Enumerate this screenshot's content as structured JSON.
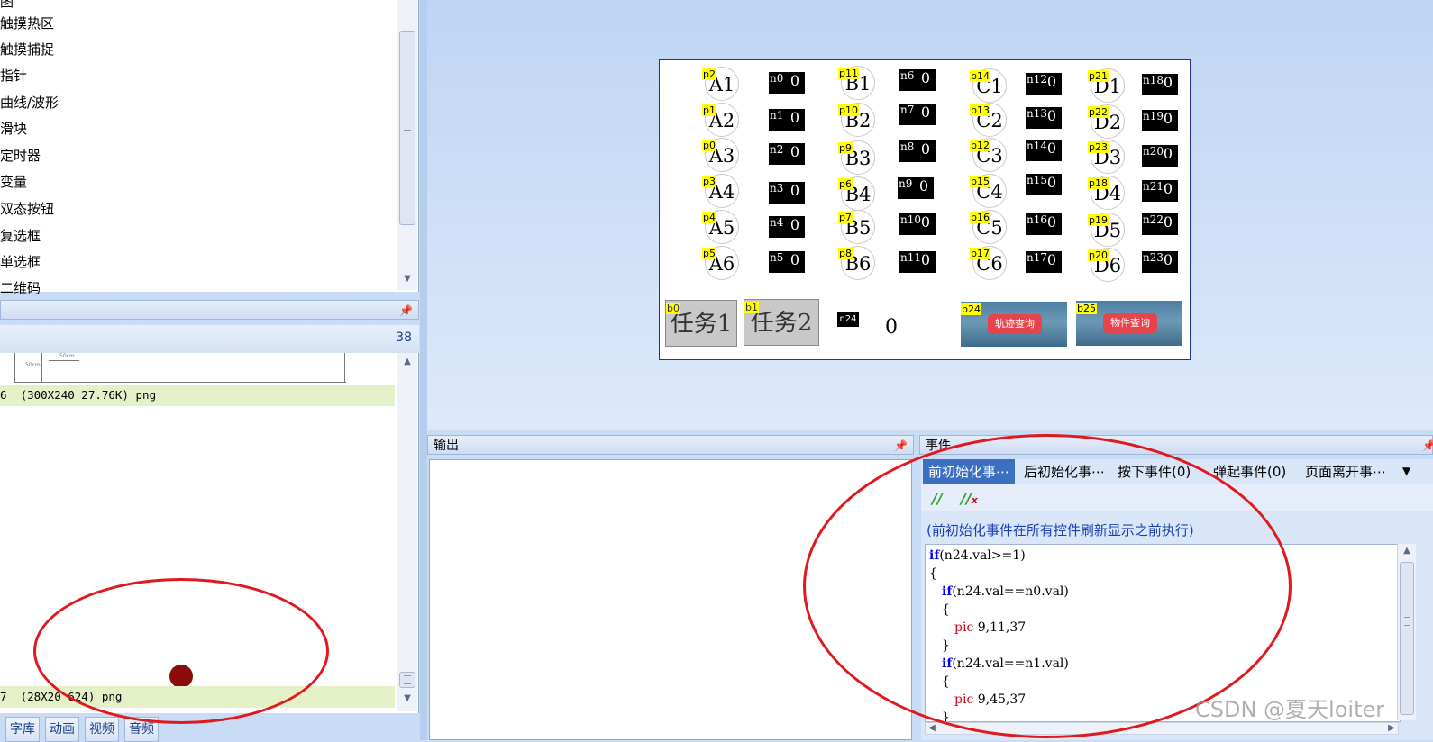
{
  "controls": {
    "items": [
      "图",
      "触摸热区",
      "触摸捕捉",
      "指针",
      "曲线/波形",
      "滑块",
      "定时器",
      "变量",
      "双态按钮",
      "复选框",
      "单选框",
      "二维码"
    ]
  },
  "attr_header": {
    "pin": "📌"
  },
  "image_panel": {
    "count": "38",
    "ruler_labels": [
      "50cm",
      "50cm"
    ],
    "row1": "6  (300X240 27.76K) png",
    "row2": "7  (28X20 624) png",
    "tabs": [
      "字库",
      "动画",
      "视频",
      "音频"
    ]
  },
  "canvas": {
    "circles_a": [
      {
        "tag": "p2",
        "label": "A1"
      },
      {
        "tag": "p1",
        "label": "A2"
      },
      {
        "tag": "p0",
        "label": "A3"
      },
      {
        "tag": "p3",
        "label": "A4"
      },
      {
        "tag": "p4",
        "label": "A5"
      },
      {
        "tag": "p5",
        "label": "A6"
      }
    ],
    "circles_b": [
      {
        "tag": "p11",
        "label": "B1"
      },
      {
        "tag": "p10",
        "label": "B2"
      },
      {
        "tag": "p9",
        "label": "B3"
      },
      {
        "tag": "p6",
        "label": "B4"
      },
      {
        "tag": "p7",
        "label": "B5"
      },
      {
        "tag": "p8",
        "label": "B6"
      }
    ],
    "circles_c": [
      {
        "tag": "p14",
        "label": "C1"
      },
      {
        "tag": "p13",
        "label": "C2"
      },
      {
        "tag": "p12",
        "label": "C3"
      },
      {
        "tag": "p15",
        "label": "C4"
      },
      {
        "tag": "p16",
        "label": "C5"
      },
      {
        "tag": "p17",
        "label": "C6"
      }
    ],
    "circles_d": [
      {
        "tag": "p21",
        "label": "D1"
      },
      {
        "tag": "p22",
        "label": "D2"
      },
      {
        "tag": "p23",
        "label": "D3"
      },
      {
        "tag": "p18",
        "label": "D4"
      },
      {
        "tag": "p19",
        "label": "D5"
      },
      {
        "tag": "p20",
        "label": "D6"
      }
    ],
    "nums_1": [
      "n0",
      "n1",
      "n2",
      "n3",
      "n4",
      "n5"
    ],
    "nums_2": [
      "n6",
      "n7",
      "n8",
      "n9",
      "n10",
      "n11"
    ],
    "nums_3": [
      "n12",
      "n13",
      "n14",
      "n15",
      "n16",
      "n17"
    ],
    "nums_4": [
      "n18",
      "n19",
      "n20",
      "n21",
      "n22",
      "n23"
    ],
    "num_digit": "0",
    "btn_task1": {
      "tag": "b0",
      "label": "任务1"
    },
    "btn_task2": {
      "tag": "b1",
      "label": "任务2"
    },
    "n24": {
      "tag": "n24",
      "value": "0"
    },
    "btn_track": {
      "tag": "b24",
      "label": "轨迹查询"
    },
    "btn_item": {
      "tag": "b25",
      "label": "物件查询"
    }
  },
  "output": {
    "title": "输出",
    "pin": "📌"
  },
  "events": {
    "title": "事件",
    "pin": "📌",
    "tabs": [
      "前初始化事⋯",
      "后初始化事⋯",
      "按下事件(0)",
      "弹起事件(0)",
      "页面离开事⋯"
    ],
    "hint": "(前初始化事件在所有控件刷新显示之前执行)",
    "code": [
      {
        "kw": "if",
        "rest": "(n24.val>=1)",
        "indent": 0
      },
      {
        "kw": "",
        "rest": "{",
        "indent": 0
      },
      {
        "kw": "if",
        "rest": "(n24.val==n0.val)",
        "indent": 1
      },
      {
        "kw": "",
        "rest": "{",
        "indent": 1
      },
      {
        "fn": "pic",
        "rest": " 9,11,37",
        "indent": 2
      },
      {
        "kw": "",
        "rest": "}",
        "indent": 1
      },
      {
        "kw": "if",
        "rest": "(n24.val==n1.val)",
        "indent": 1
      },
      {
        "kw": "",
        "rest": "{",
        "indent": 1
      },
      {
        "fn": "pic",
        "rest": " 9,45,37",
        "indent": 2
      },
      {
        "kw": "",
        "rest": "}",
        "indent": 1
      }
    ]
  },
  "watermark": "CSDN @夏天loiter",
  "colors": {
    "accent": "#3d6fc0",
    "annotation": "#e0191f",
    "tag": "#ffff00"
  }
}
